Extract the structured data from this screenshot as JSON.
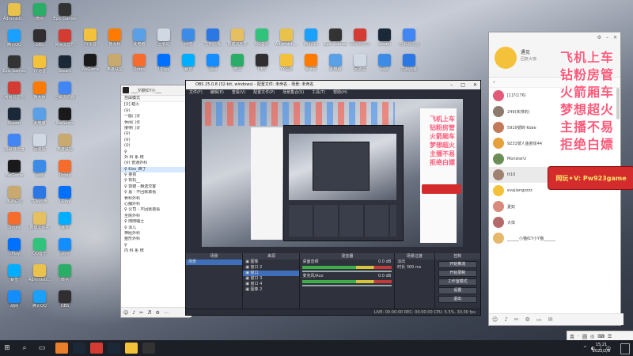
{
  "desktop": {
    "icons": [
      {
        "label": "Administr...",
        "color": "#e8c24a"
      },
      {
        "label": "腾讯QQ",
        "color": "#1aa0ff"
      },
      {
        "label": "Epic Games",
        "color": "#333"
      },
      {
        "label": "网易云音乐",
        "color": "#d43c33"
      },
      {
        "label": "Steam",
        "color": "#1b2838"
      },
      {
        "label": "谷歌浏览器",
        "color": "#4285f4"
      },
      {
        "label": "WeGame",
        "color": "#1a1a1a"
      },
      {
        "label": "英雄联盟",
        "color": "#c8aa6e"
      },
      {
        "label": "Origin",
        "color": "#f56c2d"
      },
      {
        "label": "UPlay",
        "color": "#0070ff"
      },
      {
        "label": "暴雪",
        "color": "#00aeff"
      },
      {
        "label": "战网",
        "color": "#148eff"
      },
      {
        "label": "微信",
        "color": "#2aae67"
      },
      {
        "label": "OBS",
        "color": "#302e31"
      },
      {
        "label": "YY语音",
        "color": "#f4c13a"
      },
      {
        "label": "鲁大师",
        "color": "#ff7a00"
      },
      {
        "label": "此电脑",
        "color": "#5aa0e6"
      },
      {
        "label": "回收站",
        "color": "#cfd8e3"
      },
      {
        "label": "网络",
        "color": "#3c8ce7"
      },
      {
        "label": "控制面板",
        "color": "#2b78e4"
      },
      {
        "label": "新建文件夹",
        "color": "#e6c060"
      },
      {
        "label": "QQ音乐",
        "color": "#31c27c"
      }
    ]
  },
  "taskbar": {
    "start": "⊞",
    "search": "⌕",
    "taskview": "▭",
    "apps": [
      "#e97e2b",
      "#1b2838",
      "#d43c33",
      "#1b2838",
      "#f4c13a",
      "#333"
    ],
    "tray": [
      "^",
      "◐",
      "♪",
      "中"
    ],
    "time": "15:21",
    "date": "2022/2/8"
  },
  "ime": {
    "items": [
      "英",
      "·",
      "圆",
      "◎",
      "⌨",
      "☰"
    ]
  },
  "yy_left": {
    "title": "___夕颜红Y小___",
    "mode": "自由模式",
    "rows": [
      {
        "text": "[♀] 蜡火",
        "hl": false
      },
      {
        "text": "  (♀)",
        "hl": false
      },
      {
        "text": "    一般门诊",
        "hl": false
      },
      {
        "text": "    休闲门诊",
        "hl": false
      },
      {
        "text": "    接待门诊",
        "hl": false
      },
      {
        "text": "  (♀)",
        "hl": false
      },
      {
        "text": "  (♀)",
        "hl": false
      },
      {
        "text": "  (♀)",
        "hl": false
      },
      {
        "text": "  ♀",
        "hl": false
      },
      {
        "text": "    外 科 系 统",
        "hl": false
      },
      {
        "text": "  (♀) 普通外科",
        "hl": false
      },
      {
        "text": "  ♀ Kiss_西丁",
        "hl": true
      },
      {
        "text": "  ♀ 要孩",
        "hl": false
      },
      {
        "text": "  ♀ 有机__",
        "hl": false
      },
      {
        "text": "  ♀ 郭嫂 - 赫选交客",
        "hl": false
      },
      {
        "text": "  ♀ 嘉 - 不回就敢看",
        "hl": false
      },
      {
        "text": "    骨科外科",
        "hl": false
      },
      {
        "text": "    心胸外科",
        "hl": false
      },
      {
        "text": "  ♀ 公司 - 不回就敢看",
        "hl": false
      },
      {
        "text": "    全院外科",
        "hl": false
      },
      {
        "text": "  ♀ 随随睡士",
        "hl": false
      },
      {
        "text": "  ♀ 泳儿",
        "hl": false
      },
      {
        "text": "    神经外科",
        "hl": false
      },
      {
        "text": "    整形外科",
        "hl": false
      },
      {
        "text": "  ♀",
        "hl": false
      },
      {
        "text": "    内 科 系 统",
        "hl": false
      }
    ],
    "footer": [
      "☺",
      "♪",
      "✂",
      "♬",
      "⚙",
      "⋯"
    ]
  },
  "obs": {
    "title": "OBS 25.0.8 (32-bit, windows) - 配置文件: 未命名 - 场景: 未命名",
    "menu": [
      "文件(F)",
      "编辑(E)",
      "查看(V)",
      "配置文件(P)",
      "场景集合(S)",
      "工具(T)",
      "帮助(H)"
    ],
    "docks": {
      "scenes": {
        "header": "场景",
        "items": [
          "场景"
        ]
      },
      "sources": {
        "header": "来源",
        "items": [
          "图像",
          "窗口 2",
          "窗口",
          "窗口 3",
          "窗口 4",
          "图像 2"
        ]
      },
      "mixer": {
        "header": "混音器",
        "items": [
          "桌面音频",
          "0.0 dB",
          "麦克风/Aux",
          "0.0 dB"
        ]
      },
      "transitions": {
        "header": "场景过渡",
        "items": [
          "淡出",
          "时长",
          "300 ms"
        ]
      },
      "controls": {
        "header": "控制",
        "buttons": [
          "开始推流",
          "开始录制",
          "工作室模式",
          "设置",
          "退出"
        ]
      }
    },
    "status": "LIVE: 00:00:00   REC: 00:00:00   CPU: 5.5%, 30.00 fps"
  },
  "yy_right": {
    "username": "遇见",
    "subtitle": "回复大咖",
    "channel": "[1]7(176)",
    "users": [
      {
        "name": "[1]7(176)",
        "color": "#e25c7a"
      },
      {
        "name": "249(未排的)",
        "color": "#8b7a6d"
      },
      {
        "name": "5919號帥 Kobe",
        "color": "#c27a5b"
      },
      {
        "name": "9231號人鱼丽泉44",
        "color": "#e6a03c"
      },
      {
        "name": "MonsterU",
        "color": "#6b8e56"
      },
      {
        "name": "tt10",
        "color": "#a08070"
      },
      {
        "name": "evajiangzzzz",
        "color": "#f4c13a"
      },
      {
        "name": "夏奴",
        "color": "#d98a7a"
      },
      {
        "name": "大体",
        "color": "#b46a6a"
      },
      {
        "name": "______小猫红Y小Y猫______",
        "color": "#e5b86c"
      }
    ],
    "selected_index": 5,
    "footer": [
      "☺",
      "♪",
      "✂",
      "⚙",
      "▭",
      "✉"
    ]
  },
  "overlay": {
    "lines": [
      "飞机上车",
      "钻粉房管",
      "火箭厢车",
      "梦想超火",
      "主播不易",
      "拒绝白嫖"
    ],
    "banner": "网玩✦V: Pw923game"
  }
}
